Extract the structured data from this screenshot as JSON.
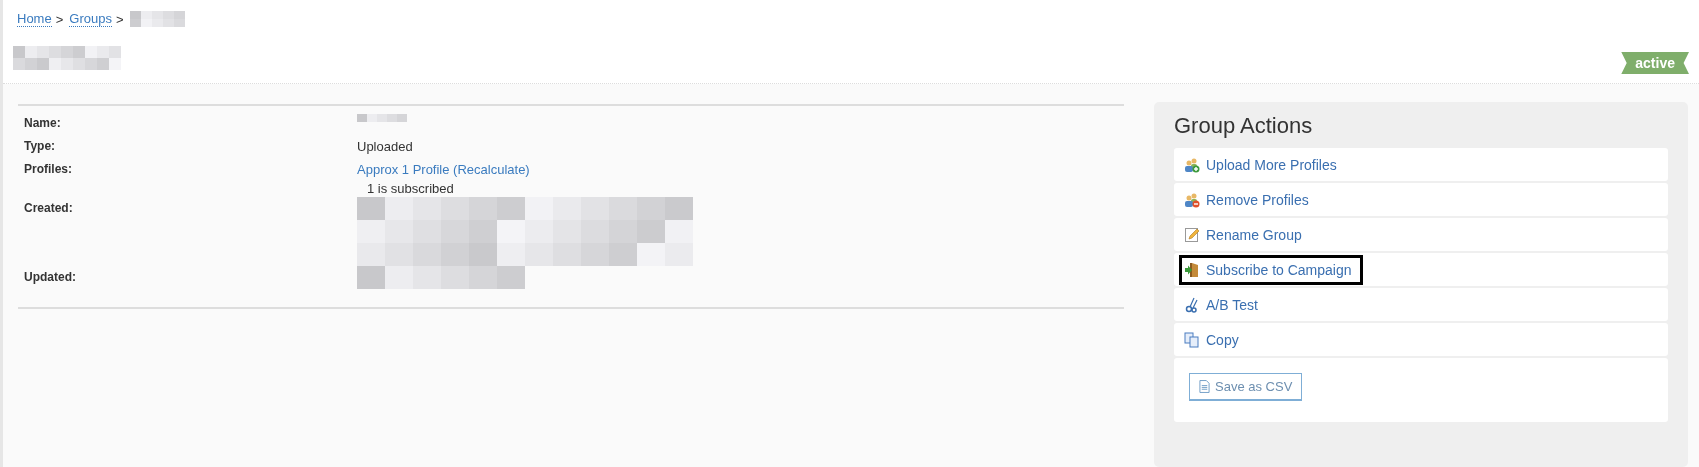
{
  "breadcrumb": [
    {
      "label": "Home",
      "kind": "link",
      "separator": ">"
    },
    {
      "label": "Groups",
      "kind": "link",
      "separator": ">"
    },
    {
      "kind": "redacted"
    }
  ],
  "status_badge": "active",
  "details": [
    {
      "label": "Name:",
      "kind": "redacted-short"
    },
    {
      "label": "Type:",
      "kind": "text",
      "value": "Uploaded"
    },
    {
      "label": "Profiles:",
      "kind": "link",
      "value": "Approx 1 Profile (Recalculate)",
      "note": "1 is subscribed"
    },
    {
      "label": "Created:",
      "kind": "redacted-block"
    },
    {
      "label": "Updated:",
      "kind": "redacted-line"
    }
  ],
  "group_actions": {
    "title": "Group Actions",
    "items": [
      {
        "label": "Upload More Profiles",
        "kind": "add-people",
        "highlighted": false
      },
      {
        "label": "Remove Profiles",
        "kind": "remove-people",
        "highlighted": false
      },
      {
        "label": "Rename Group",
        "kind": "rename",
        "highlighted": false
      },
      {
        "label": "Subscribe to Campaign",
        "kind": "subscribe",
        "highlighted": true
      },
      {
        "label": "A/B Test",
        "kind": "ab-test",
        "highlighted": false
      },
      {
        "label": "Copy",
        "kind": "copy",
        "highlighted": false
      }
    ],
    "export_button": "Save as CSV"
  }
}
